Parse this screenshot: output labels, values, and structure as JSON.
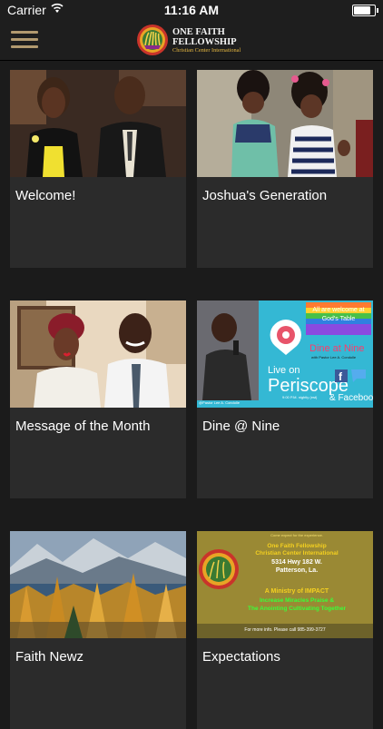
{
  "status_bar": {
    "carrier": "Carrier",
    "time": "11:16 AM",
    "battery_level": 0.8
  },
  "nav": {
    "menu_icon": "hamburger-icon",
    "logo_line1": "ONE FAITH",
    "logo_line2": "FELLOWSHIP",
    "logo_line3": "Christian Center International"
  },
  "cards": [
    {
      "title": "Welcome!"
    },
    {
      "title": "Joshua's Generation"
    },
    {
      "title": "Message of the Month"
    },
    {
      "title": "Dine @ Nine",
      "image_text": {
        "welcome1": "All are welcome at",
        "welcome2": "God's Table",
        "dine": "Dine at Nine",
        "pastor": "with Pastor Lee A. Condolle",
        "live": "Live on",
        "periscope": "Periscope",
        "time": "9:00 P.M. nightly (est)",
        "facebook": "& Facebook",
        "handle": "@Pastor Lee A. Condolle"
      }
    },
    {
      "title": "Faith Newz"
    },
    {
      "title": "Expectations",
      "image_text": {
        "top": "Come expect for the experience.",
        "name1": "One Faith Fellowship",
        "name2": "Christian Center International",
        "address": "5314 Hwy 182 W.",
        "city": "Patterson, La.",
        "ministry": "A Ministry of IMPACT",
        "motto1": "Increase Miracles Praise &",
        "motto2": "The Anointing Cultivating Together",
        "info": "For more info. Please call 985-399-3727"
      }
    }
  ],
  "colors": {
    "background": "#1b1b1b",
    "card": "#2b2b2b",
    "menu_icon": "#b29a6f",
    "periscope_bg": "#34b8d4"
  }
}
